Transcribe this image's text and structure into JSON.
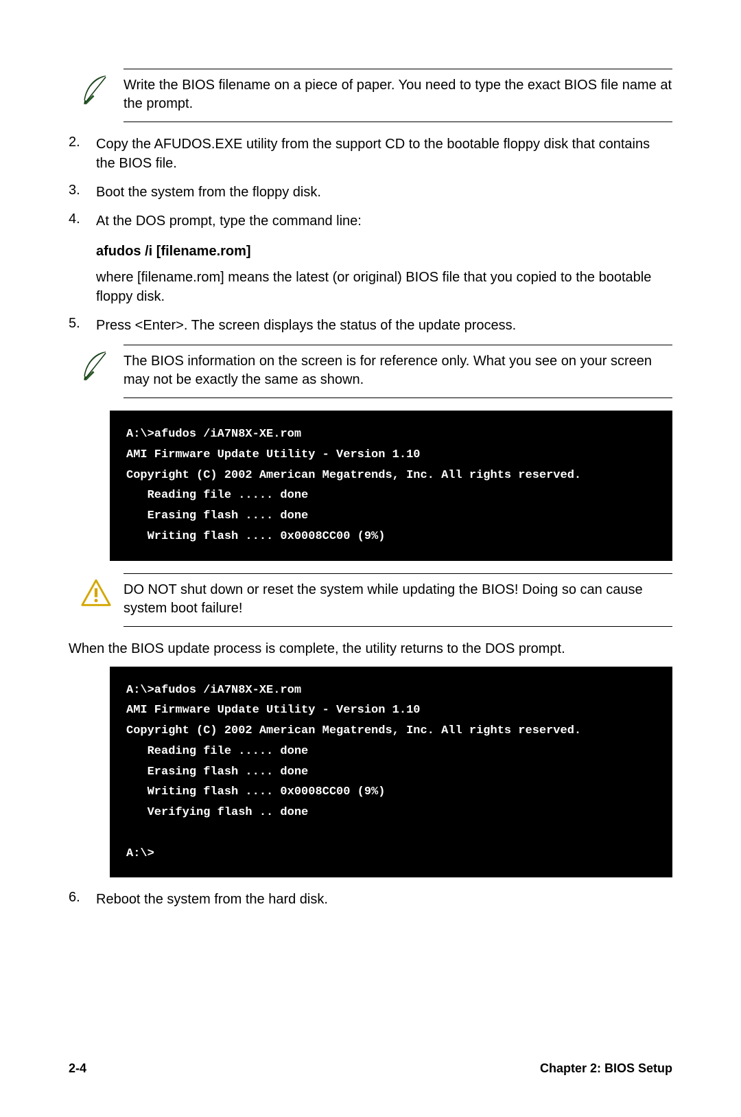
{
  "notes": {
    "note1": "Write the BIOS filename on a piece of paper. You need to type the exact BIOS file name at the prompt.",
    "note2": "The BIOS information on the screen is for reference only. What you see on your screen may not be exactly the same as shown.",
    "warning": "DO NOT shut down or reset the system while updating the BIOS! Doing so can cause system boot failure!"
  },
  "steps": {
    "s2": {
      "num": "2.",
      "text": "Copy the AFUDOS.EXE utility from the support CD to the bootable floppy disk that contains the BIOS file."
    },
    "s3": {
      "num": "3.",
      "text": "Boot the system from the floppy disk."
    },
    "s4": {
      "num": "4.",
      "text": "At the DOS prompt, type the command line:",
      "cmd": "afudos /i [filename.rom]",
      "explain": "where [filename.rom] means the latest (or original) BIOS file that you copied to the bootable floppy disk."
    },
    "s5": {
      "num": "5.",
      "text": "Press <Enter>. The screen displays the status of the update process."
    },
    "s6": {
      "num": "6.",
      "text": "Reboot the system from the hard disk."
    }
  },
  "terminal1": "A:\\>afudos /iA7N8X-XE.rom\nAMI Firmware Update Utility - Version 1.10\nCopyright (C) 2002 American Megatrends, Inc. All rights reserved.\n   Reading file ..... done\n   Erasing flash .... done\n   Writing flash .... 0x0008CC00 (9%)",
  "paragraph_after_warning": "When the BIOS update process is complete, the utility returns to the DOS prompt.",
  "terminal2": "A:\\>afudos /iA7N8X-XE.rom\nAMI Firmware Update Utility - Version 1.10\nCopyright (C) 2002 American Megatrends, Inc. All rights reserved.\n   Reading file ..... done\n   Erasing flash .... done\n   Writing flash .... 0x0008CC00 (9%)\n   Verifying flash .. done\n\nA:\\>",
  "footer": {
    "page_num": "2-4",
    "chapter": "Chapter 2: BIOS Setup"
  }
}
